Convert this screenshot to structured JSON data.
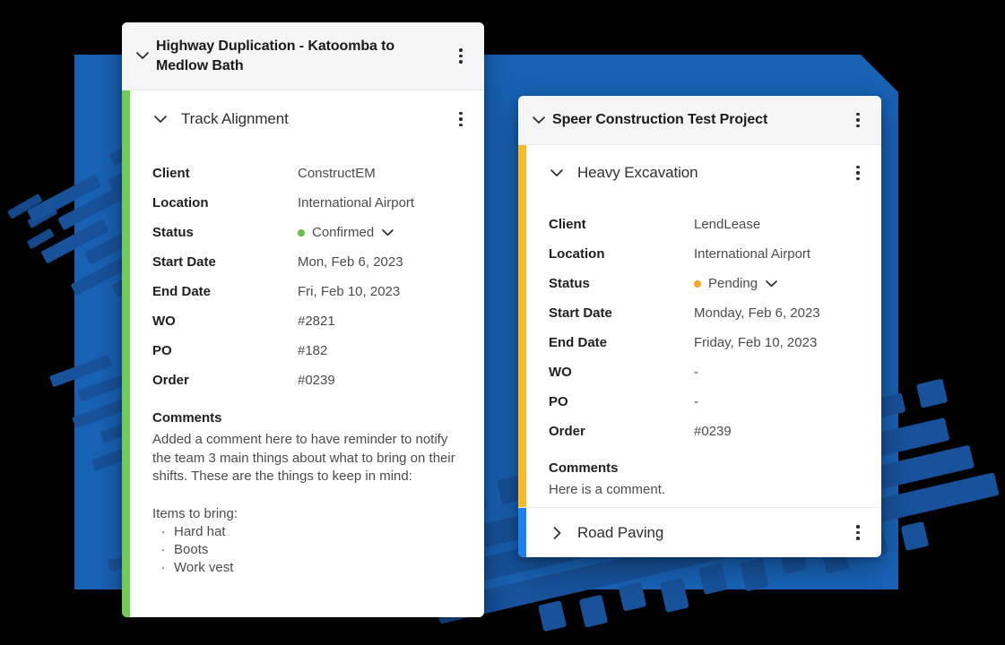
{
  "theme": {
    "page_background": "#000000",
    "panel_blue": "#1862B5",
    "tire_track_blue": "#17529B",
    "card_header_bg": "#F5F5F5",
    "card_bg": "#FFFFFF"
  },
  "cards": [
    {
      "id": "highway-duplication",
      "title": "Highway Duplication - Katoomba to Medlow Bath",
      "collapse_icon": "chevron-down-icon",
      "menu_icon": "kebab-menu-icon",
      "section": {
        "name": "Track Alignment",
        "accent_color": "#6FCB52",
        "collapse_icon": "chevron-down-icon",
        "menu_icon": "kebab-menu-icon",
        "rows": [
          {
            "label": "Client",
            "value": "ConstructEM"
          },
          {
            "label": "Location",
            "value": "International Airport"
          },
          {
            "label": "Status",
            "value": "Confirmed",
            "dot_color": "#6ABF4B",
            "has_dropdown": true
          },
          {
            "label": "Start Date",
            "value": "Mon, Feb 6, 2023"
          },
          {
            "label": "End Date",
            "value": "Fri, Feb 10, 2023"
          },
          {
            "label": "WO",
            "value": "#2821"
          },
          {
            "label": "PO",
            "value": "#182"
          },
          {
            "label": "Order",
            "value": "#0239"
          }
        ],
        "comments_label": "Comments",
        "comments_text": "Added a comment here to have reminder to notify the team 3 main things about what to bring on their shifts. These are the things to keep in mind:\n\nItems to bring:",
        "comment_bullets": [
          "Hard hat",
          "Boots",
          "Work vest"
        ],
        "bullet_mark": "·"
      }
    },
    {
      "id": "speer-construction",
      "title": "Speer Construction Test Project",
      "collapse_icon": "chevron-down-icon",
      "menu_icon": "kebab-menu-icon",
      "section": {
        "name": "Heavy Excavation",
        "accent_color": "#F7B928",
        "collapse_icon": "chevron-down-icon",
        "menu_icon": "kebab-menu-icon",
        "rows": [
          {
            "label": "Client",
            "value": "LendLease"
          },
          {
            "label": "Location",
            "value": "International Airport"
          },
          {
            "label": "Status",
            "value": "Pending",
            "dot_color": "#F5A623",
            "has_dropdown": true
          },
          {
            "label": "Start Date",
            "value": "Monday, Feb 6, 2023"
          },
          {
            "label": "End Date",
            "value": "Friday, Feb 10, 2023"
          },
          {
            "label": "WO",
            "value": "-"
          },
          {
            "label": "PO",
            "value": "-"
          },
          {
            "label": "Order",
            "value": "#0239"
          }
        ],
        "comments_label": "Comments",
        "comments_text": "Here is a comment."
      },
      "collapsed_section": {
        "name": "Road Paving",
        "accent_color": "#1F7FEB",
        "expand_icon": "chevron-right-icon",
        "menu_icon": "kebab-menu-icon"
      }
    }
  ]
}
